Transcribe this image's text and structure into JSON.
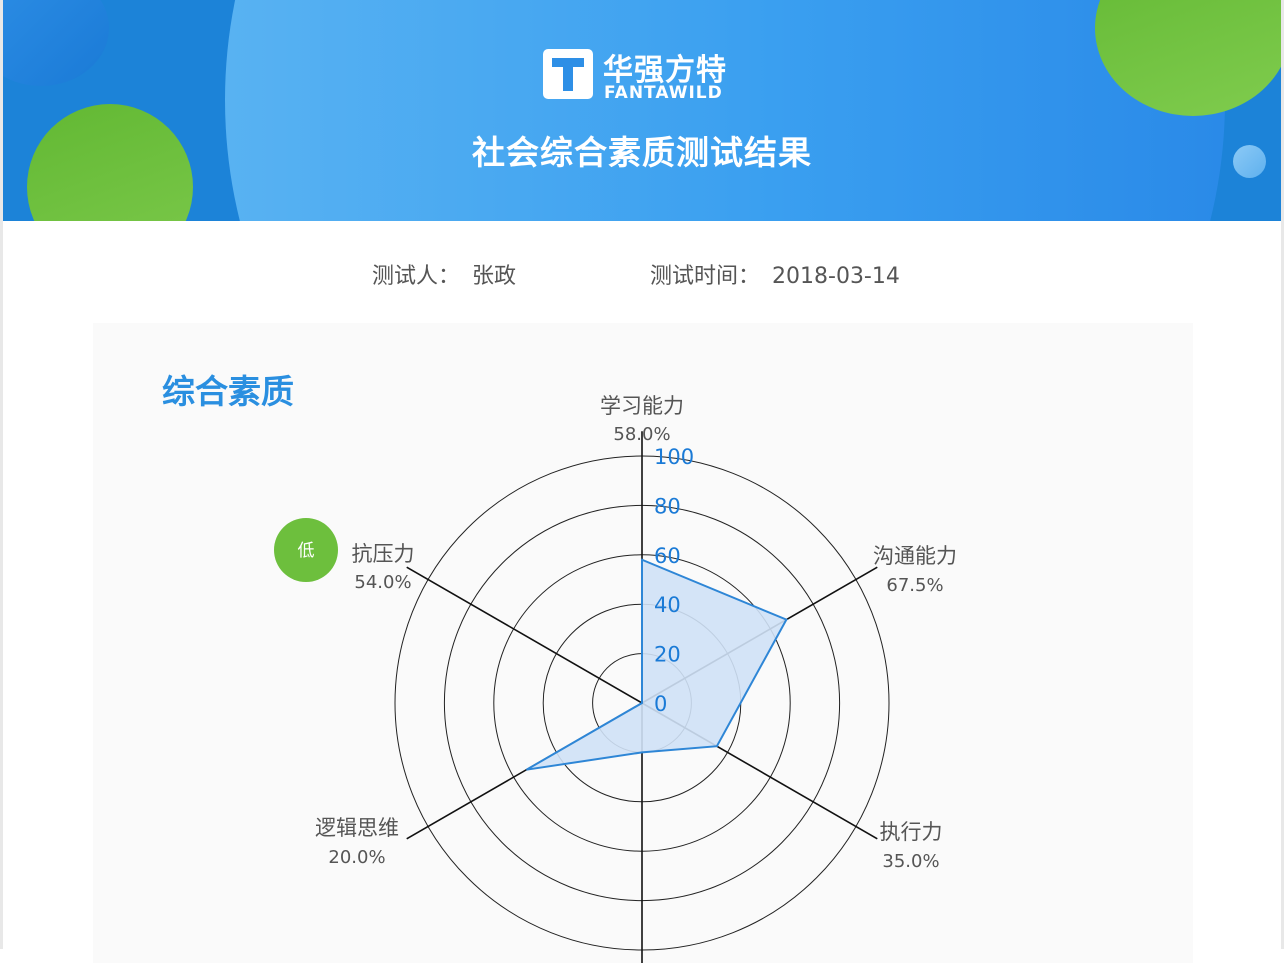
{
  "brand": {
    "name_cn": "华强方特",
    "name_en": "FANTAWILD"
  },
  "header": {
    "title": "社会综合素质测试结果"
  },
  "meta": {
    "tester_label": "测试人：",
    "tester_name": "张政",
    "time_label": "测试时间：",
    "time_value": "2018-03-14"
  },
  "card": {
    "title": "综合素质",
    "low_badge": "低",
    "low_badge_color": "#6dbf3d"
  },
  "colors": {
    "banner_blue": "#1c83d8",
    "accent_blue": "#2a8fe0",
    "accent_green": "#6dbf3d",
    "fill_area": "#cfe1f6",
    "stroke_area": "#2e86d6"
  },
  "chart_data": {
    "type": "radar",
    "title": "综合素质",
    "categories": [
      "学习能力",
      "沟通能力",
      "执行力",
      "逻辑思维",
      "抗压力",
      ""
    ],
    "values": [
      58.0,
      67.5,
      35.0,
      20.0,
      54.0
    ],
    "value_labels": [
      "58.0%",
      "67.5%",
      "35.0%",
      "20.0%",
      "54.0%"
    ],
    "radial_ticks": [
      0,
      20,
      40,
      60,
      80,
      100
    ],
    "range": [
      0,
      100
    ],
    "lowest_category": "抗压力"
  }
}
